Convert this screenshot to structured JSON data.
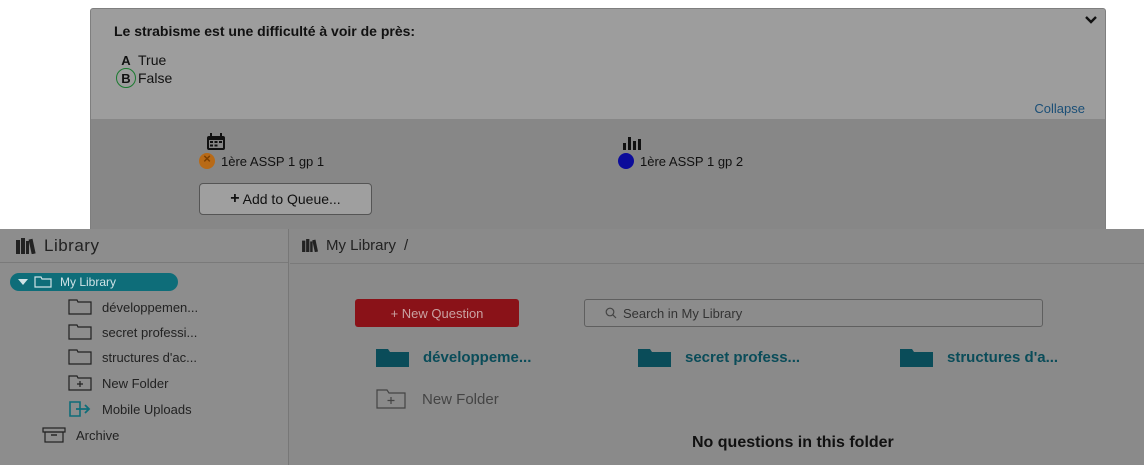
{
  "question": {
    "text": "Le strabisme est une difficulté à voir de près:",
    "options": [
      {
        "letter": "A",
        "label": "True",
        "correct": false
      },
      {
        "letter": "B",
        "label": "False",
        "correct": true
      }
    ],
    "collapse_label": "Collapse",
    "sessions": [
      {
        "icon": "calendar-icon",
        "label": "1ère ASSP 1 gp 1",
        "status_color": "#b86a17"
      },
      {
        "icon": "bar-chart-icon",
        "label": "1ère ASSP 1 gp 2",
        "status_color": "#0c0c9a"
      }
    ],
    "add_to_queue_label": "Add to Queue..."
  },
  "sidebar": {
    "title": "Library",
    "root": "My Library",
    "items": [
      {
        "label": "développemen...",
        "icon": "folder-icon"
      },
      {
        "label": "secret professi...",
        "icon": "folder-icon"
      },
      {
        "label": "structures d'ac...",
        "icon": "folder-icon"
      },
      {
        "label": "New Folder",
        "icon": "new-folder-icon"
      },
      {
        "label": "Mobile Uploads",
        "icon": "upload-icon"
      },
      {
        "label": "Archive",
        "icon": "archive-icon"
      }
    ]
  },
  "main": {
    "breadcrumb": {
      "label": "My Library",
      "sep": "/"
    },
    "new_question_label": "+ New Question",
    "search": {
      "placeholder": "Search in My Library"
    },
    "folders": [
      {
        "label": "développeme..."
      },
      {
        "label": "secret profess..."
      },
      {
        "label": "structures d'a..."
      }
    ],
    "new_folder_label": "New Folder",
    "empty_message": "No questions in this folder"
  },
  "colors": {
    "accent_teal": "#0e6d79",
    "new_question_red": "#8a1218",
    "folder_teal": "#0a4c59",
    "correct_green": "#1a7a2f"
  }
}
